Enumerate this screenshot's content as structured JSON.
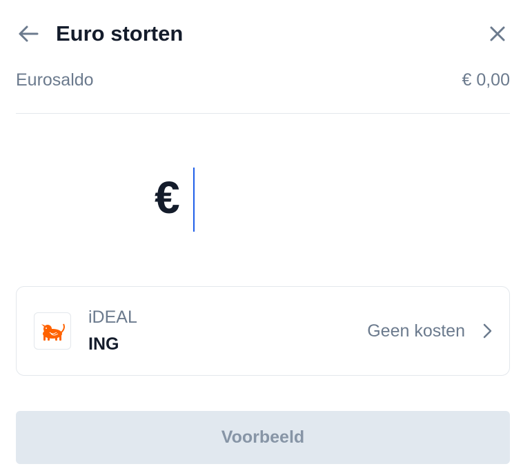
{
  "header": {
    "title": "Euro storten",
    "back_icon": "arrow-left-icon",
    "close_icon": "close-icon"
  },
  "balance": {
    "label": "Eurosaldo",
    "value": "€ 0,00"
  },
  "amount": {
    "currency_symbol": "€",
    "value": ""
  },
  "payment_method": {
    "type": "iDEAL",
    "bank": "ING",
    "fee": "Geen kosten",
    "logo_icon": "ing-lion-logo",
    "chevron_icon": "chevron-right-icon"
  },
  "actions": {
    "preview_label": "Voorbeeld",
    "preview_enabled": false
  },
  "colors": {
    "text_primary": "#141c2b",
    "text_secondary": "#6b7a8d",
    "caret": "#1f5ee8",
    "button_disabled_bg": "#e1e8ef",
    "button_disabled_text": "#8795a6",
    "ing_orange": "#ff6200"
  }
}
